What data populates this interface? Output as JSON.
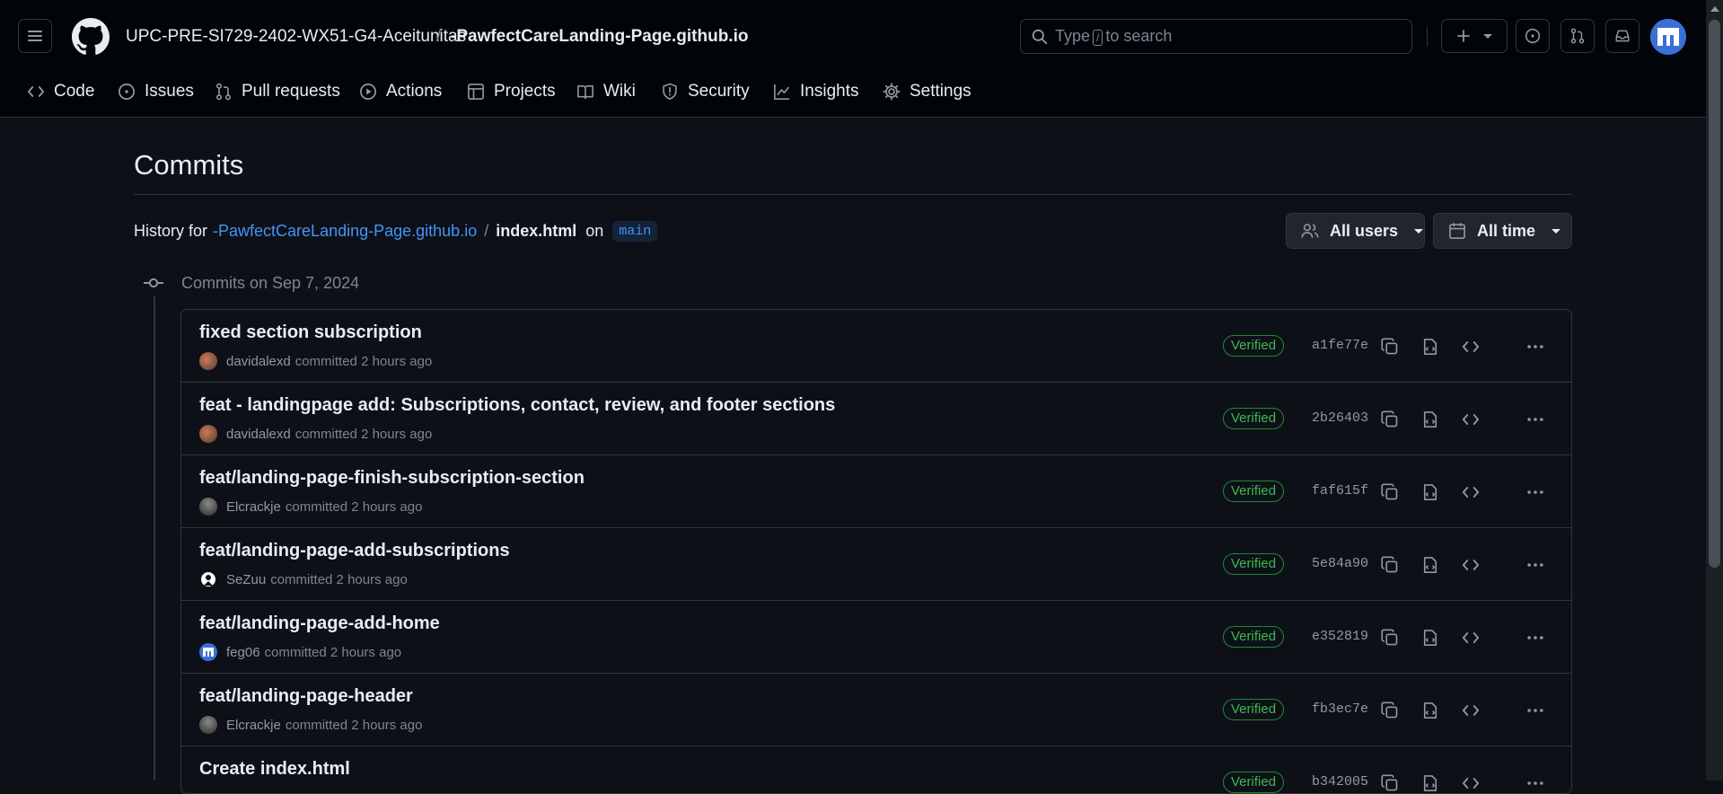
{
  "header": {
    "owner": "UPC-PRE-SI729-2402-WX51-G4-Aceitunitas",
    "separator": "/",
    "repo": "-PawfectCareLanding-Page.github.io",
    "search": {
      "before": "Type",
      "key": "/",
      "after": "to search"
    }
  },
  "nav": [
    {
      "label": "Code",
      "icon": "code-icon"
    },
    {
      "label": "Issues",
      "icon": "issue-icon"
    },
    {
      "label": "Pull requests",
      "icon": "pull-request-icon"
    },
    {
      "label": "Actions",
      "icon": "play-icon"
    },
    {
      "label": "Projects",
      "icon": "table-icon"
    },
    {
      "label": "Wiki",
      "icon": "book-icon"
    },
    {
      "label": "Security",
      "icon": "shield-icon"
    },
    {
      "label": "Insights",
      "icon": "graph-icon"
    },
    {
      "label": "Settings",
      "icon": "gear-icon"
    }
  ],
  "page": {
    "title": "Commits",
    "history_prefix": "History for",
    "history_repo": "-PawfectCareLanding-Page.github.io",
    "history_sep": "/",
    "history_file": "index.html",
    "history_on": "on",
    "branch": "main",
    "filter_users": "All users",
    "filter_time": "All time",
    "group_label": "Commits on Sep 7, 2024"
  },
  "commits": [
    {
      "title": "fixed section subscription",
      "author": "davidalexd",
      "time": "committed 2 hours ago",
      "badge": "Verified",
      "sha": "a1fe77e"
    },
    {
      "title": "feat - landingpage add: Subscriptions, contact, review, and footer sections",
      "author": "davidalexd",
      "time": "committed 2 hours ago",
      "badge": "Verified",
      "sha": "2b26403"
    },
    {
      "title": "feat/landing-page-finish-subscription-section",
      "author": "Elcrackje",
      "time": "committed 2 hours ago",
      "badge": "Verified",
      "sha": "faf615f"
    },
    {
      "title": "feat/landing-page-add-subscriptions",
      "author": "SeZuu",
      "time": "committed 2 hours ago",
      "badge": "Verified",
      "sha": "5e84a90"
    },
    {
      "title": "feat/landing-page-add-home",
      "author": "feg06",
      "time": "committed 2 hours ago",
      "badge": "Verified",
      "sha": "e352819"
    },
    {
      "title": "feat/landing-page-header",
      "author": "Elcrackje",
      "time": "committed 2 hours ago",
      "badge": "Verified",
      "sha": "fb3ec7e"
    },
    {
      "title": "Create index.html",
      "author": "",
      "time": "",
      "badge": "Verified",
      "sha": "b342005"
    }
  ],
  "colors": {
    "bg": "#0d1117",
    "header_bg": "#010409",
    "border": "#30363d",
    "link": "#4493f8",
    "verified": "#3fb950"
  }
}
